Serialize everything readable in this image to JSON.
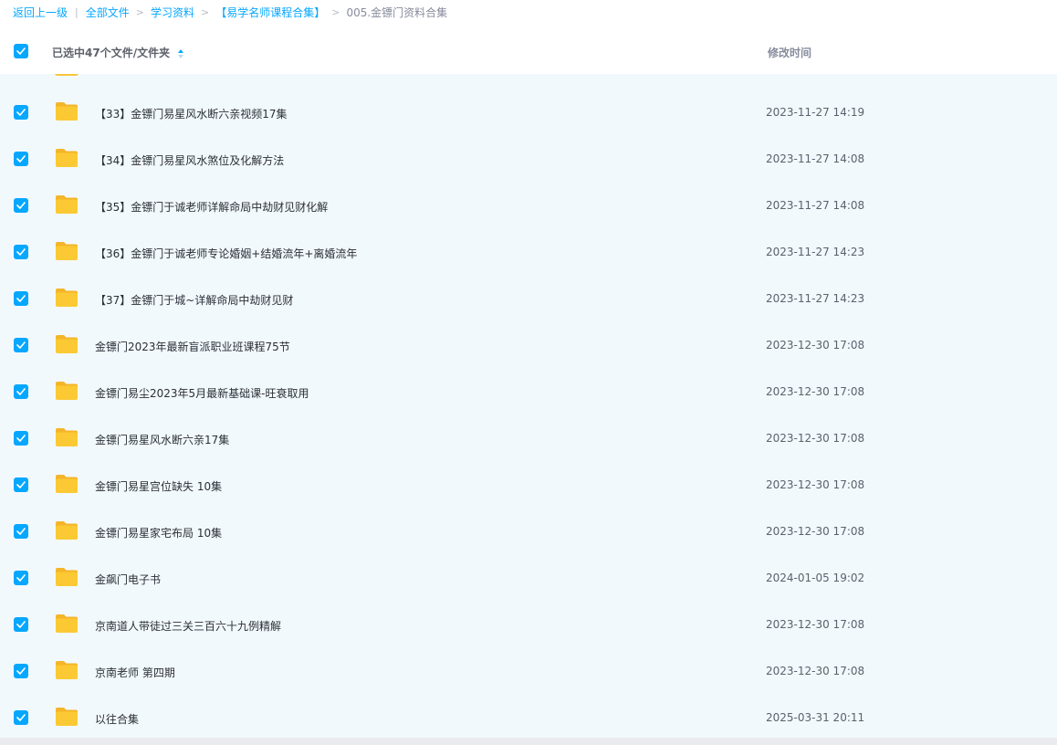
{
  "breadcrumb": {
    "back": "返回上一级",
    "separator": "|",
    "arrow": ">",
    "items": [
      "全部文件",
      "学习资料",
      "【易学名师课程合集】"
    ],
    "current": "005.金镖门资料合集"
  },
  "header": {
    "selection_text": "已选中47个文件/文件夹",
    "time_column": "修改时间",
    "all_checked": true
  },
  "files": [
    {
      "name": "【33】金镖门易星风水断六亲视频17集",
      "modified": "2023-11-27 14:19",
      "checked": true,
      "icon": "folder-icon"
    },
    {
      "name": "【34】金镖门易星风水煞位及化解方法",
      "modified": "2023-11-27 14:08",
      "checked": true,
      "icon": "folder-icon"
    },
    {
      "name": "【35】金镖门于诚老师详解命局中劫财见财化解",
      "modified": "2023-11-27 14:08",
      "checked": true,
      "icon": "folder-icon"
    },
    {
      "name": "【36】金镖门于诚老师专论婚姻+结婚流年+离婚流年",
      "modified": "2023-11-27 14:23",
      "checked": true,
      "icon": "folder-icon"
    },
    {
      "name": "【37】金镖门于城~详解命局中劫财见财",
      "modified": "2023-11-27 14:23",
      "checked": true,
      "icon": "folder-icon"
    },
    {
      "name": "金镖门2023年最新盲派职业班课程75节",
      "modified": "2023-12-30 17:08",
      "checked": true,
      "icon": "folder-icon"
    },
    {
      "name": "金镖门易尘2023年5月最新基础课-旺衰取用",
      "modified": "2023-12-30 17:08",
      "checked": true,
      "icon": "folder-icon"
    },
    {
      "name": "金镖门易星风水断六亲17集",
      "modified": "2023-12-30 17:08",
      "checked": true,
      "icon": "folder-icon"
    },
    {
      "name": "金镖门易星宫位缺失 10集",
      "modified": "2023-12-30 17:08",
      "checked": true,
      "icon": "folder-icon"
    },
    {
      "name": "金镖门易星家宅布局 10集",
      "modified": "2023-12-30 17:08",
      "checked": true,
      "icon": "folder-icon"
    },
    {
      "name": "金飙门电子书",
      "modified": "2024-01-05 19:02",
      "checked": true,
      "icon": "folder-icon"
    },
    {
      "name": "京南道人带徒过三关三百六十九例精解",
      "modified": "2023-12-30 17:08",
      "checked": true,
      "icon": "folder-icon"
    },
    {
      "name": "京南老师 第四期",
      "modified": "2023-12-30 17:08",
      "checked": true,
      "icon": "folder-icon"
    },
    {
      "name": "以往合集",
      "modified": "2025-03-31 20:11",
      "checked": true,
      "icon": "folder-icon"
    }
  ],
  "colors": {
    "accent": "#06a7ff",
    "list_background": "#f2f9fd",
    "folder": "#f8c53a"
  }
}
